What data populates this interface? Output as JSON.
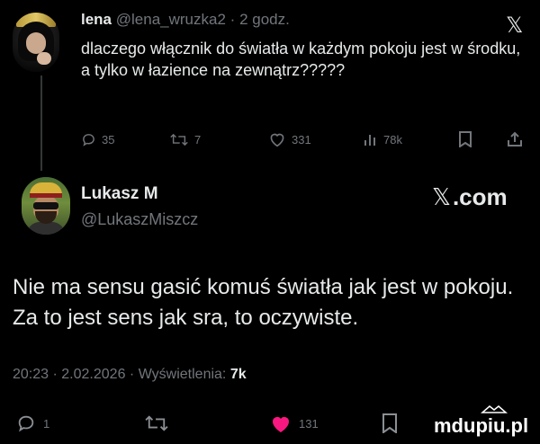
{
  "quoted_tweet": {
    "author_name": "lena",
    "handle": "@lena_wruzka2",
    "separator": "·",
    "time": "2 godz.",
    "text": "dlaczego włącznik do światła w każdym pokoju jest w środku, a tylko w łazience na zewnątrz?????",
    "stats": {
      "replies": "35",
      "reposts": "7",
      "likes": "331",
      "views": "78k"
    },
    "logo_icon": "x-logo-icon"
  },
  "main_tweet": {
    "author_name": "Lukasz M",
    "handle": "@LukaszMiszcz",
    "brand": ".com",
    "text": "Nie ma sensu gasić komuś światła jak jest w pokoju. Za to jest sens jak sra, to oczywiste.",
    "meta": {
      "time": "20:23",
      "dot": "·",
      "date": "2.02.2026",
      "views_label": "Wyświetlenia:",
      "views_value": "7k"
    },
    "actions": {
      "replies": "1",
      "likes": "131"
    }
  },
  "watermark": "mdupiu.pl",
  "colors": {
    "background": "#000000",
    "text": "#e7e9ea",
    "muted": "#71767b",
    "like": "#f91880"
  }
}
